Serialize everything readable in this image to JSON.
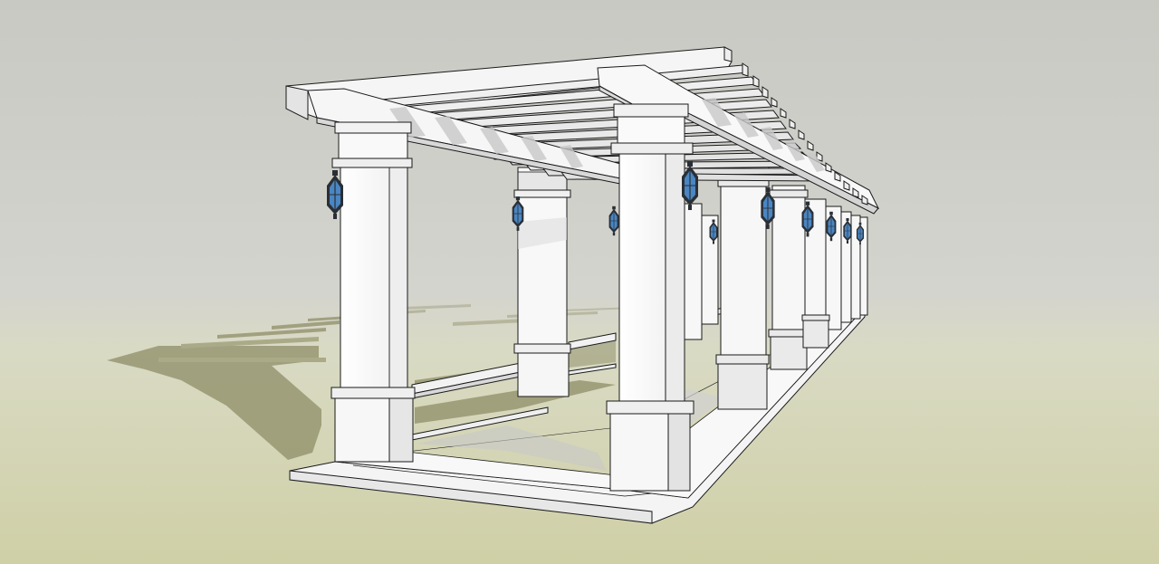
{
  "scene": {
    "subject": "pergola-walkway-3d-model",
    "colors": {
      "sky_top": "#c9c9c4",
      "sky_bottom": "#d3d3cc",
      "ground_far": "#d9dac4",
      "ground_near": "#cfd0a6",
      "shadow": "#8f8e68",
      "shadow_soft": "#b2b190",
      "structure_white": "#f7f7f7",
      "structure_shade": "#dcdcdc",
      "structure_dark": "#c4c4c4",
      "edge": "#1a1a1a",
      "lantern_glass": "#4a86c2",
      "lantern_frame": "#2a2f36"
    },
    "icons": [
      "wall-lantern-icon"
    ]
  }
}
